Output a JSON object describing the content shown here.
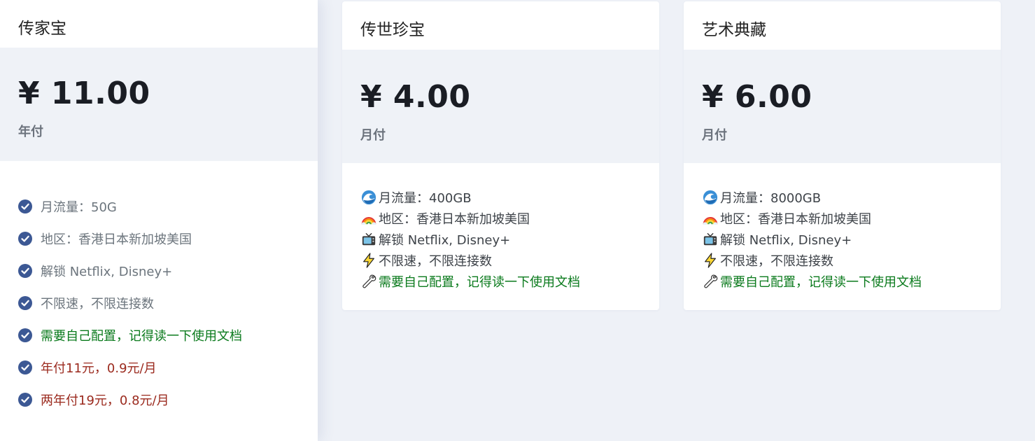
{
  "plans": [
    {
      "name": "传家宝",
      "price": "¥ 11.00",
      "period": "年付",
      "features": [
        {
          "text": "月流量：50G",
          "tone": "muted"
        },
        {
          "text": "地区：香港日本新加坡美国",
          "tone": "muted"
        },
        {
          "text": "解锁 Netflix, Disney+",
          "tone": "muted"
        },
        {
          "text": "不限速，不限连接数",
          "tone": "muted"
        },
        {
          "text": "需要自己配置，记得读一下使用文档",
          "tone": "green"
        },
        {
          "text": "年付11元，0.9元/月",
          "tone": "red"
        },
        {
          "text": "两年付19元，0.8元/月",
          "tone": "red"
        }
      ]
    },
    {
      "name": "传世珍宝",
      "price": "¥ 4.00",
      "period": "月付",
      "features": [
        {
          "icon": "wave-icon",
          "text": "月流量：400GB"
        },
        {
          "icon": "rainbow-icon",
          "text": "地区：香港日本新加坡美国"
        },
        {
          "icon": "tv-icon",
          "text": "解锁 Netflix, Disney+"
        },
        {
          "icon": "lightning-icon",
          "text": "不限速，不限连接数"
        },
        {
          "icon": "wrench-icon",
          "text": "需要自己配置，记得读一下使用文档",
          "tone": "green"
        }
      ]
    },
    {
      "name": "艺术典藏",
      "price": "¥ 6.00",
      "period": "月付",
      "features": [
        {
          "icon": "wave-icon",
          "text": "月流量：8000GB"
        },
        {
          "icon": "rainbow-icon",
          "text": "地区：香港日本新加坡美国"
        },
        {
          "icon": "tv-icon",
          "text": "解锁 Netflix, Disney+"
        },
        {
          "icon": "lightning-icon",
          "text": "不限速，不限连接数"
        },
        {
          "icon": "wrench-icon",
          "text": "需要自己配置，记得读一下使用文档",
          "tone": "green"
        }
      ]
    }
  ],
  "colors": {
    "page_bg": "#eef1f7",
    "check_icon": "#3c5894",
    "green_text": "#0a7a1c",
    "red_text": "#9b2a1e"
  }
}
